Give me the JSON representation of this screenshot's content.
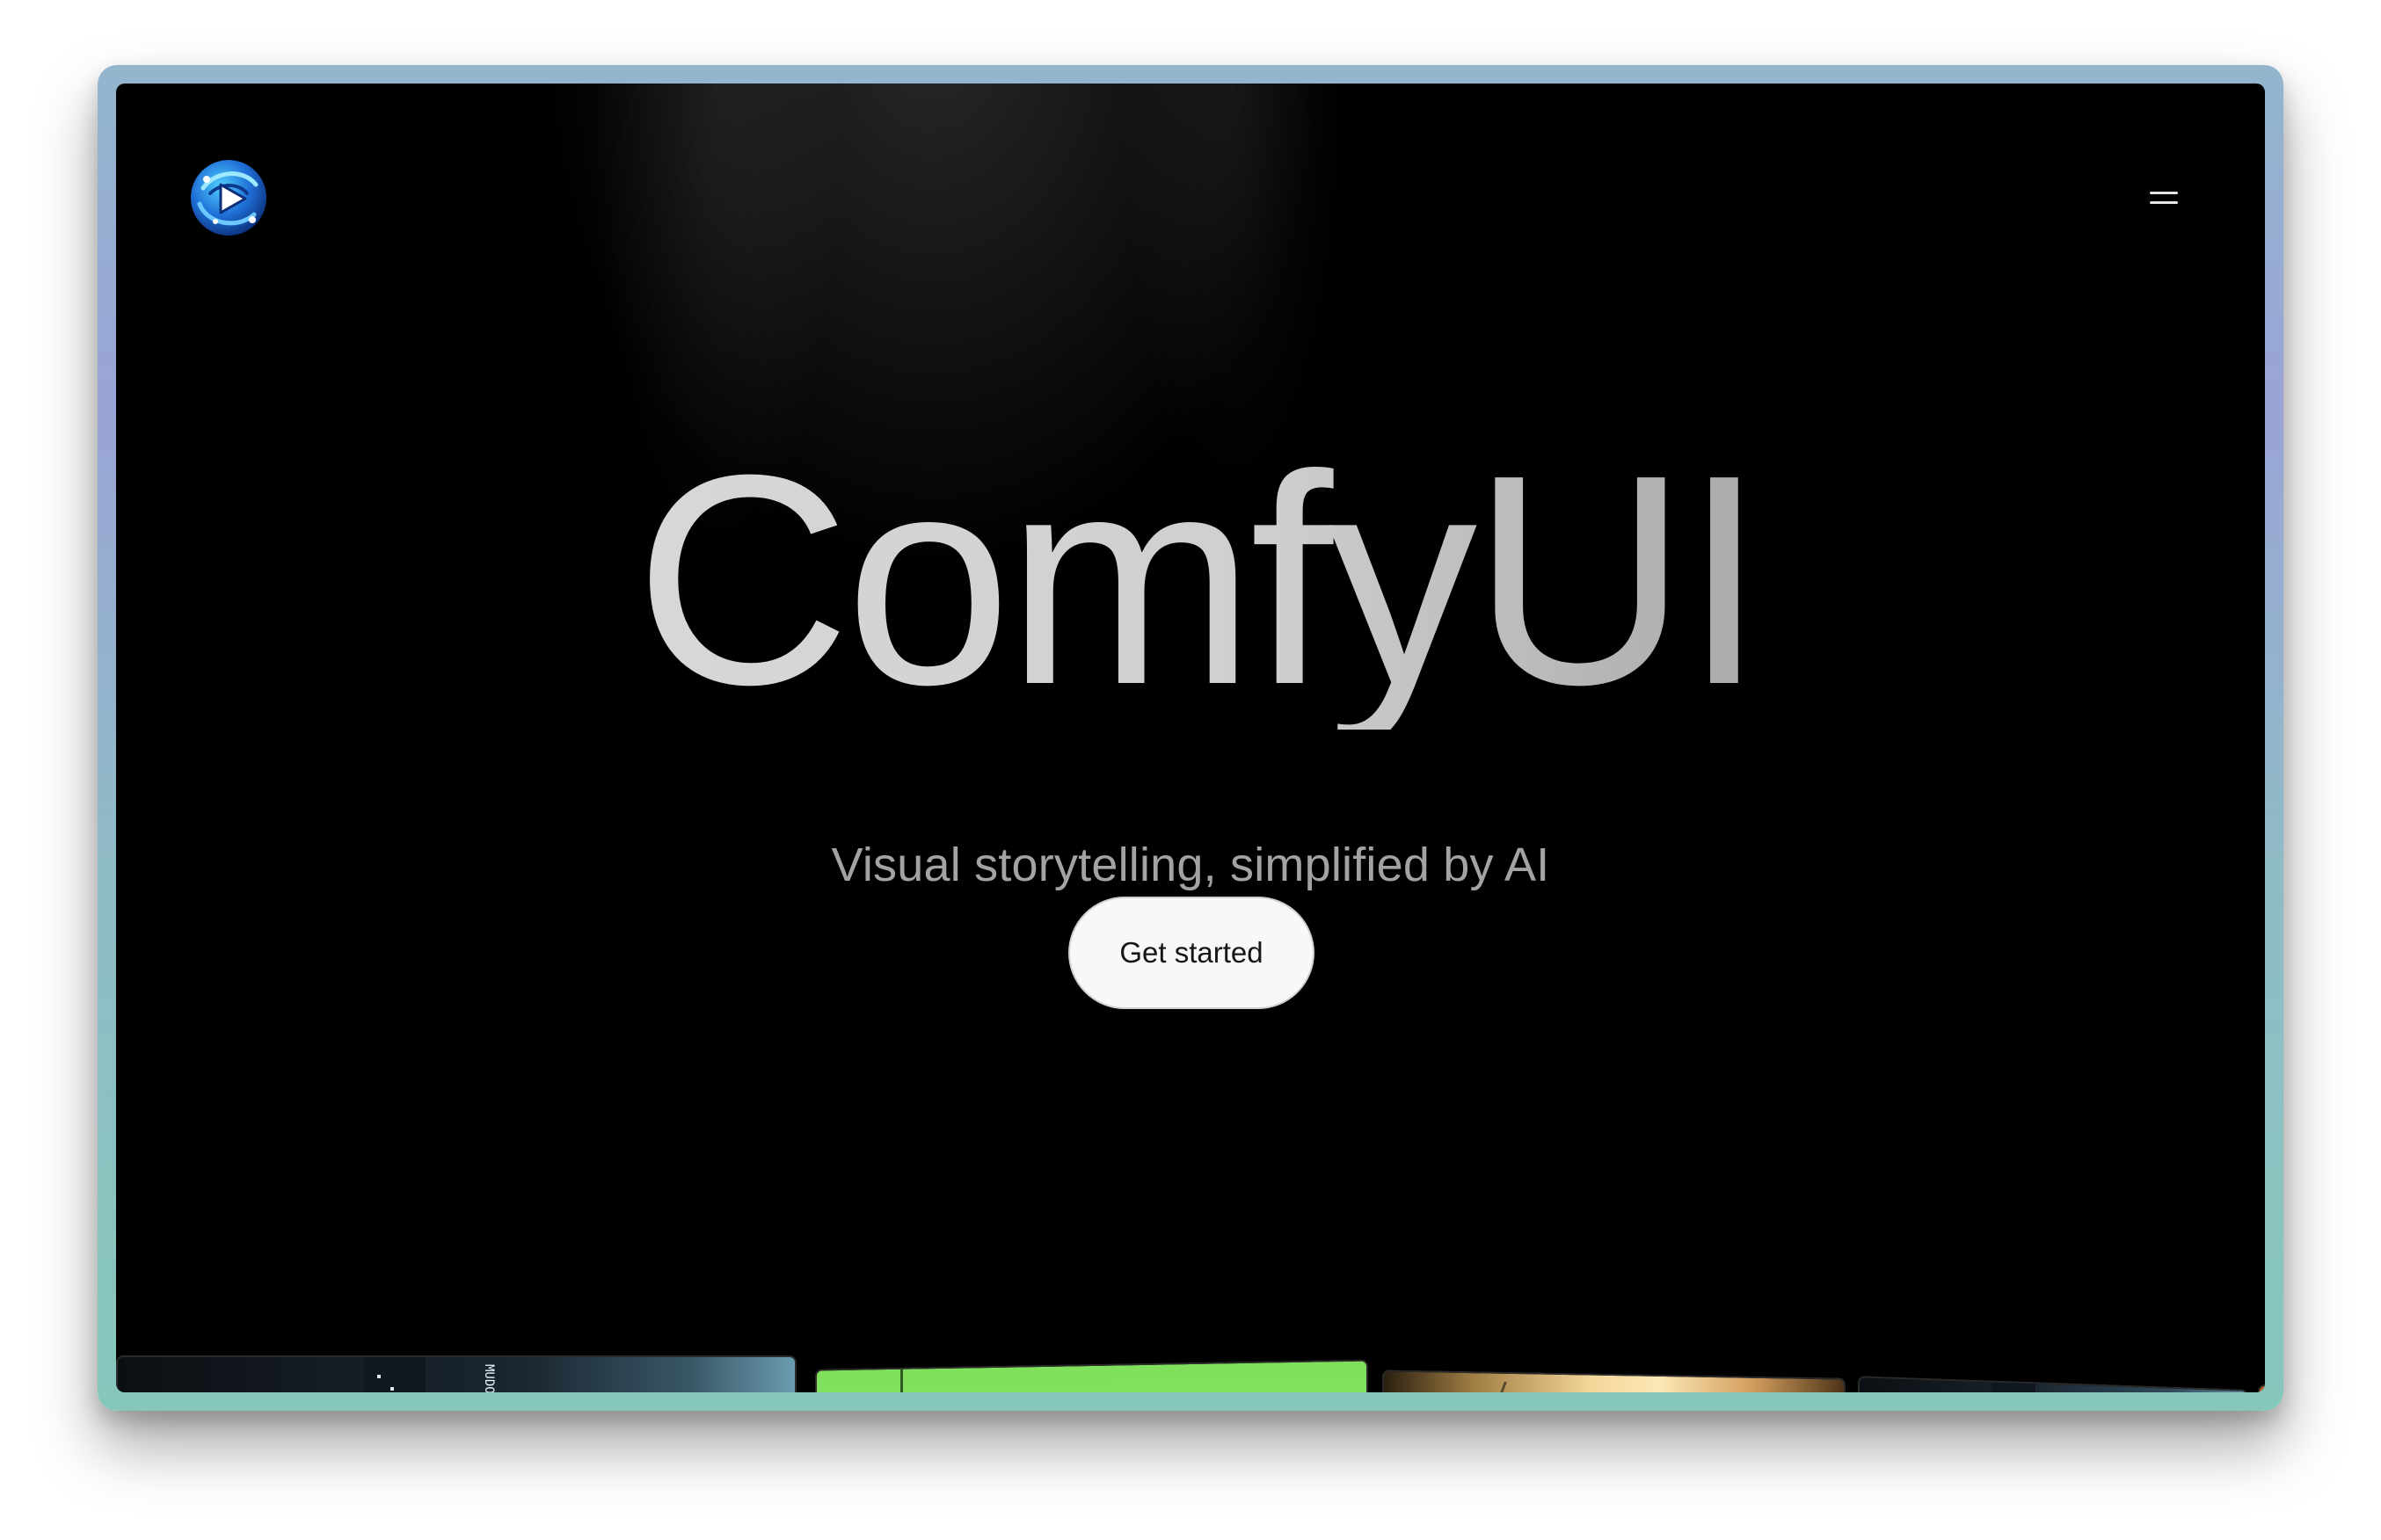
{
  "header": {
    "logo_icon": "comfyui-play-logo-icon",
    "menu_icon": "hamburger-menu-icon"
  },
  "hero": {
    "title": "ComfyUI",
    "subtitle": "Visual storytelling, simplified by AI",
    "cta_label": "Get started"
  },
  "gallery": {
    "thumbnails": [
      {
        "name": "neon-city-street"
      },
      {
        "name": "green-screen-robot"
      },
      {
        "name": "sunlit-city-skyline"
      },
      {
        "name": "neon-city-street-2"
      }
    ],
    "neon_sign_text": "MUDOAZ"
  },
  "colors": {
    "background": "#000000",
    "frame_gradient_top": "#9aa4d6",
    "frame_gradient_bottom": "#86c7bc",
    "button_bg": "#f8f8f8",
    "subtitle": "#a3a3a3"
  }
}
